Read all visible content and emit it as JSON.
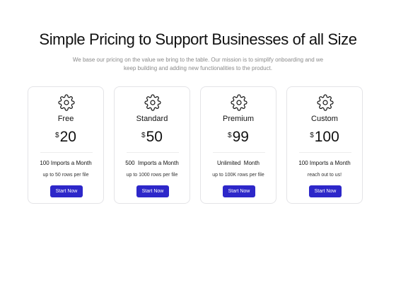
{
  "header": {
    "title": "Simple Pricing to Support Businesses of all Size",
    "subtitle_line1": "We base our pricing on the value we bring to the table. Our mission is to simplify onboarding and we",
    "subtitle_line2": "keep building and adding new functionalities to the product."
  },
  "plans": [
    {
      "icon": "gear-icon",
      "name": "Free",
      "currency": "$",
      "price": "20",
      "imports": "100 Imports a Month",
      "rows": "up to 50 rows per file",
      "button": "Start Now"
    },
    {
      "icon": "gear-icon",
      "name": "Standard",
      "currency": "$",
      "price": "50",
      "imports": "500  Imports a Month",
      "rows": "up to 1000 rows per file",
      "button": "Start Now"
    },
    {
      "icon": "gear-icon",
      "name": "Premium",
      "currency": "$",
      "price": "99",
      "imports": "Unlimited  Month",
      "rows": "up to 100K rows per file",
      "button": "Start Now"
    },
    {
      "icon": "gear-icon",
      "name": "Custom",
      "currency": "$",
      "price": "100",
      "imports": "100 Imports a Month",
      "rows": "reach out to us!",
      "button": "Start Now"
    }
  ],
  "colors": {
    "accent": "#2d27c9",
    "card_border": "#e4e4e7",
    "muted_text": "#8a8a8a"
  }
}
